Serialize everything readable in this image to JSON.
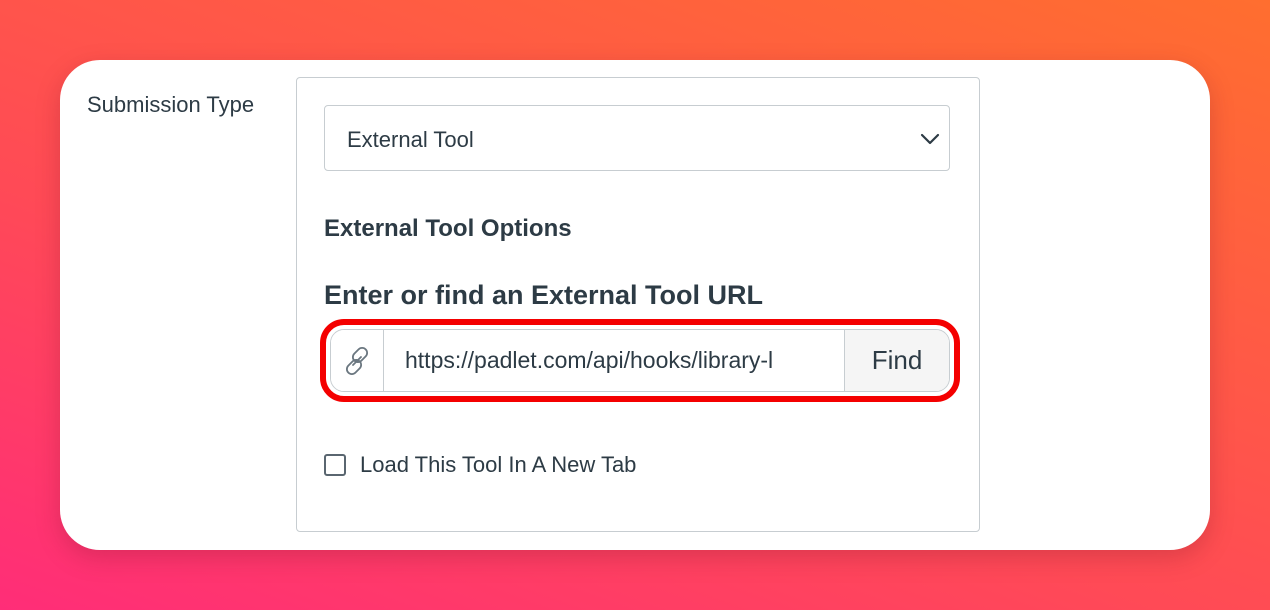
{
  "form": {
    "submission_type_label": "Submission Type",
    "submission_type_value": "External Tool",
    "options_heading": "External Tool Options",
    "url_label": "Enter or find an External Tool URL",
    "url_value": "https://padlet.com/api/hooks/library-l",
    "find_label": "Find",
    "new_tab_label": "Load This Tool In A New Tab",
    "new_tab_checked": false
  },
  "icons": {
    "select_chevron": "chevron-down-icon",
    "url_prefix": "link-icon"
  },
  "colors": {
    "highlight": "#f40000",
    "text": "#2d3b45",
    "border": "#c7cdd1",
    "button_bg": "#f5f5f5"
  }
}
